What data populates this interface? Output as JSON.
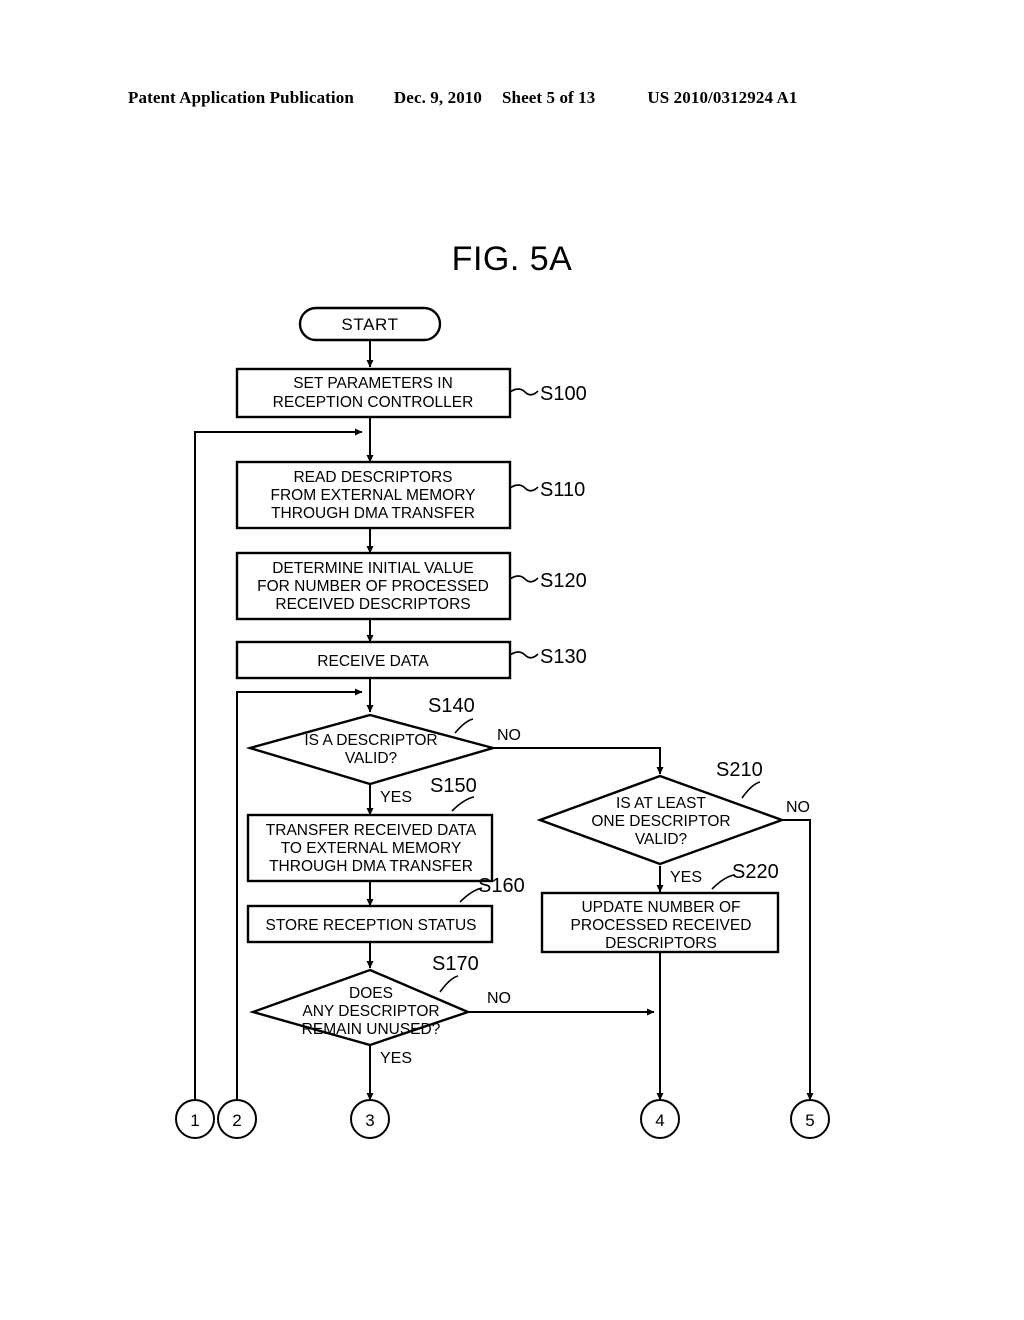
{
  "header": {
    "publication": "Patent Application Publication",
    "date": "Dec. 9, 2010",
    "sheet": "Sheet 5 of 13",
    "number": "US 2010/0312924 A1"
  },
  "figure": {
    "title": "FIG. 5A"
  },
  "chart_data": {
    "type": "diagram",
    "title": "FIG. 5A",
    "nodes": [
      {
        "id": "start",
        "shape": "terminator",
        "label": "START",
        "step": ""
      },
      {
        "id": "s100",
        "shape": "process",
        "label": "SET PARAMETERS IN RECEPTION CONTROLLER",
        "step": "S100"
      },
      {
        "id": "s110",
        "shape": "process",
        "label": "READ DESCRIPTORS FROM EXTERNAL MEMORY THROUGH DMA TRANSFER",
        "step": "S110"
      },
      {
        "id": "s120",
        "shape": "process",
        "label": "DETERMINE INITIAL VALUE FOR NUMBER OF PROCESSED RECEIVED DESCRIPTORS",
        "step": "S120"
      },
      {
        "id": "s130",
        "shape": "process",
        "label": "RECEIVE DATA",
        "step": "S130"
      },
      {
        "id": "s140",
        "shape": "decision",
        "label": "IS A DESCRIPTOR VALID?",
        "step": "S140"
      },
      {
        "id": "s150",
        "shape": "process",
        "label": "TRANSFER RECEIVED DATA TO EXTERNAL MEMORY THROUGH DMA TRANSFER",
        "step": "S150"
      },
      {
        "id": "s160",
        "shape": "process",
        "label": "STORE RECEPTION STATUS",
        "step": "S160"
      },
      {
        "id": "s170",
        "shape": "decision",
        "label": "DOES ANY DESCRIPTOR REMAIN UNUSED?",
        "step": "S170"
      },
      {
        "id": "s210",
        "shape": "decision",
        "label": "IS AT LEAST ONE DESCRIPTOR VALID?",
        "step": "S210"
      },
      {
        "id": "s220",
        "shape": "process",
        "label": "UPDATE NUMBER OF PROCESSED RECEIVED DESCRIPTORS",
        "step": "S220"
      }
    ],
    "connectors": [
      {
        "id": "c1",
        "label": "1"
      },
      {
        "id": "c2",
        "label": "2"
      },
      {
        "id": "c3",
        "label": "3"
      },
      {
        "id": "c4",
        "label": "4"
      },
      {
        "id": "c5",
        "label": "5"
      }
    ],
    "edges": [
      {
        "from": "start",
        "to": "s100",
        "label": ""
      },
      {
        "from": "s100",
        "to": "s110",
        "label": ""
      },
      {
        "from": "s110",
        "to": "s120",
        "label": ""
      },
      {
        "from": "s120",
        "to": "s130",
        "label": ""
      },
      {
        "from": "s130",
        "to": "s140",
        "label": ""
      },
      {
        "from": "s140",
        "to": "s150",
        "label": "YES"
      },
      {
        "from": "s140",
        "to": "s210",
        "label": "NO"
      },
      {
        "from": "s150",
        "to": "s160",
        "label": ""
      },
      {
        "from": "s160",
        "to": "s170",
        "label": ""
      },
      {
        "from": "s170",
        "to": "c3",
        "label": "YES"
      },
      {
        "from": "s170",
        "to": "c4",
        "label": "NO"
      },
      {
        "from": "s210",
        "to": "s220",
        "label": "YES"
      },
      {
        "from": "s210",
        "to": "c5",
        "label": "NO"
      },
      {
        "from": "s220",
        "to": "c4",
        "label": ""
      },
      {
        "from": "c1",
        "to": "s110",
        "label": ""
      },
      {
        "from": "c2",
        "to": "s140",
        "label": ""
      }
    ]
  },
  "nodes": {
    "start": {
      "label": "START"
    },
    "s100": {
      "line1": "SET PARAMETERS IN",
      "line2": "RECEPTION CONTROLLER",
      "step": "S100"
    },
    "s110": {
      "line1": "READ DESCRIPTORS",
      "line2": "FROM EXTERNAL MEMORY",
      "line3": "THROUGH DMA TRANSFER",
      "step": "S110"
    },
    "s120": {
      "line1": "DETERMINE INITIAL VALUE",
      "line2": "FOR NUMBER OF PROCESSED",
      "line3": "RECEIVED DESCRIPTORS",
      "step": "S120"
    },
    "s130": {
      "line1": "RECEIVE DATA",
      "step": "S130"
    },
    "s140": {
      "line1": "IS A DESCRIPTOR",
      "line2": "VALID?",
      "step": "S140",
      "yes": "YES",
      "no": "NO"
    },
    "s150": {
      "line1": "TRANSFER RECEIVED DATA",
      "line2": "TO EXTERNAL MEMORY",
      "line3": "THROUGH DMA TRANSFER",
      "step": "S150"
    },
    "s160": {
      "line1": "STORE RECEPTION STATUS",
      "step": "S160"
    },
    "s170": {
      "line1": "DOES",
      "line2": "ANY DESCRIPTOR",
      "line3": "REMAIN UNUSED?",
      "step": "S170",
      "yes": "YES",
      "no": "NO"
    },
    "s210": {
      "line1": "IS AT LEAST",
      "line2": "ONE DESCRIPTOR",
      "line3": "VALID?",
      "step": "S210",
      "yes": "YES",
      "no": "NO"
    },
    "s220": {
      "line1": "UPDATE NUMBER OF",
      "line2": "PROCESSED RECEIVED",
      "line3": "DESCRIPTORS",
      "step": "S220"
    }
  },
  "connectors": {
    "c1": "1",
    "c2": "2",
    "c3": "3",
    "c4": "4",
    "c5": "5"
  },
  "colors": {
    "ink": "#000000",
    "paper": "#ffffff"
  }
}
